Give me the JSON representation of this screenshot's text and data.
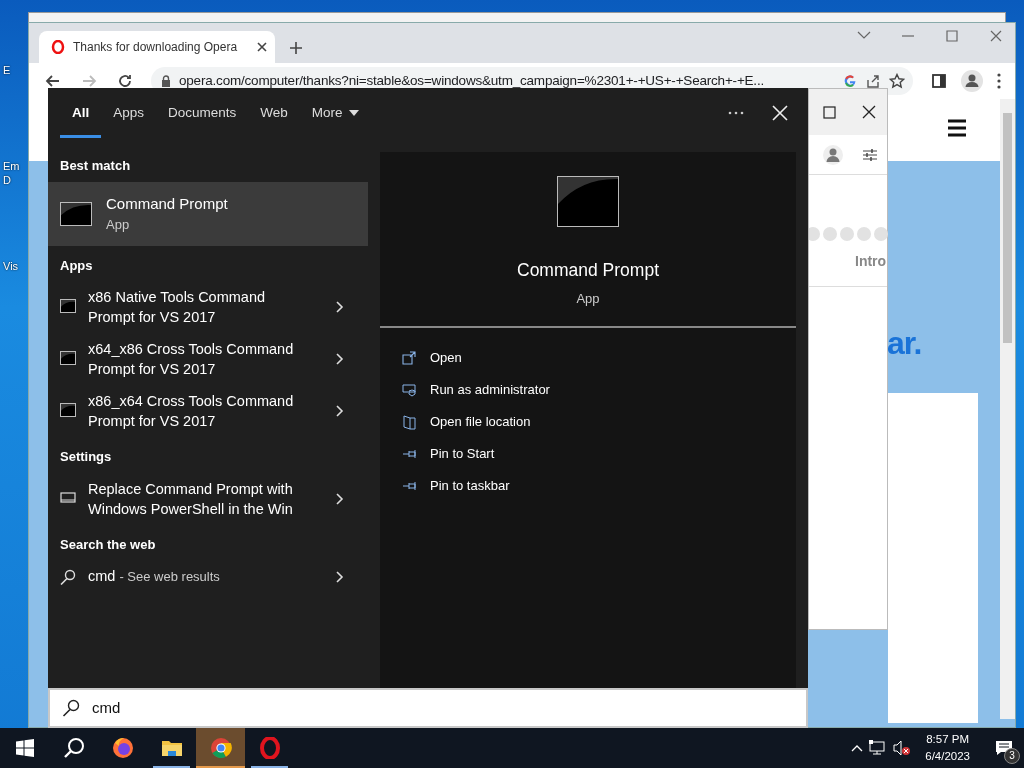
{
  "desktop": {
    "icon_labels": [
      "E",
      "Em",
      "D",
      "Vis"
    ]
  },
  "browser": {
    "tab": {
      "title": "Thanks for downloading Opera"
    },
    "url": "opera.com/computer/thanks?ni=stable&os=windows&utm_campaign=%2301+-+US+-+Search+-+E..."
  },
  "page": {
    "heading_fragment": "ar.",
    "tab_fragment": "Intro"
  },
  "search": {
    "tabs": [
      {
        "label": "All",
        "selected": true
      },
      {
        "label": "Apps",
        "selected": false
      },
      {
        "label": "Documents",
        "selected": false
      },
      {
        "label": "Web",
        "selected": false
      },
      {
        "label": "More",
        "selected": false
      }
    ],
    "best_match": {
      "title": "Best match",
      "name": "Command Prompt",
      "subtitle": "App",
      "selected": true
    },
    "groups": [
      {
        "title": "Apps",
        "items": [
          {
            "kind": "app",
            "text": "x86 Native Tools Command Prompt for VS 2017"
          },
          {
            "kind": "app",
            "text": "x64_x86 Cross Tools Command Prompt for VS 2017"
          },
          {
            "kind": "app",
            "text": "x86_x64 Cross Tools Command Prompt for VS 2017"
          }
        ]
      },
      {
        "title": "Settings",
        "items": [
          {
            "kind": "setting",
            "text": "Replace Command Prompt with Windows PowerShell in the Win"
          }
        ]
      },
      {
        "title": "Search the web",
        "items": [
          {
            "kind": "web",
            "text": "cmd",
            "suffix": "- See web results"
          }
        ]
      }
    ],
    "preview": {
      "title": "Command Prompt",
      "subtitle": "App",
      "actions": [
        {
          "kind": "open",
          "label": "Open"
        },
        {
          "kind": "admin",
          "label": "Run as administrator"
        },
        {
          "kind": "folder",
          "label": "Open file location"
        },
        {
          "kind": "pin",
          "label": "Pin to Start"
        },
        {
          "kind": "pin",
          "label": "Pin to taskbar"
        }
      ]
    },
    "query": "cmd"
  },
  "taskbar": {
    "apps": [
      {
        "kind": "firefox",
        "running": false,
        "active": false
      },
      {
        "kind": "explorer",
        "running": true,
        "active": false
      },
      {
        "kind": "chrome",
        "running": true,
        "active": true
      },
      {
        "kind": "opera",
        "running": true,
        "active": false
      }
    ],
    "time": "8:57 PM",
    "date": "6/4/2023",
    "notifications": "3"
  }
}
